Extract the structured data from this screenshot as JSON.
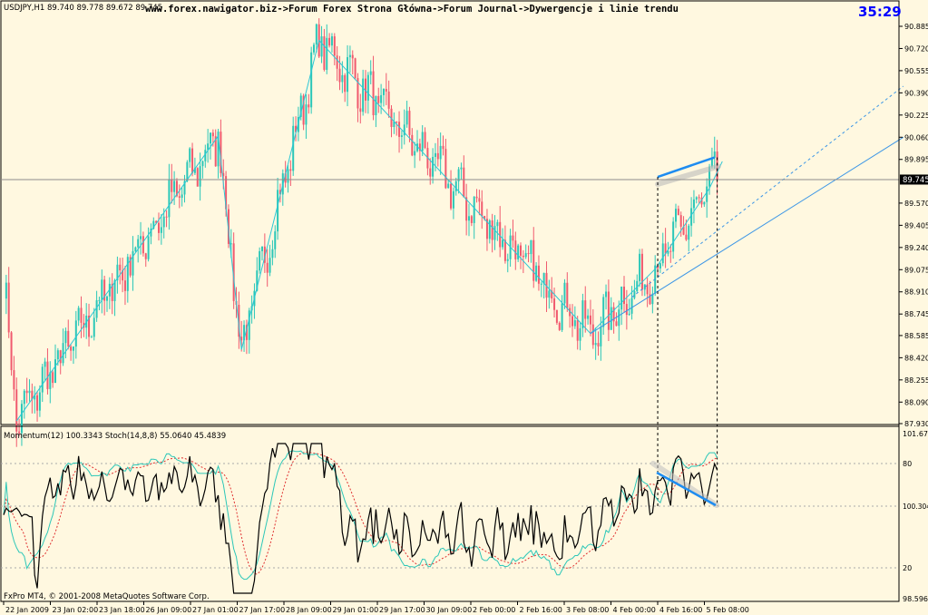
{
  "header": {
    "symbol_info": "USDJPY,H1  89.740 89.778 89.672 89.745",
    "title": "www.forex.nawigator.biz->Forum Forex Strona Główna->Forum Journal->Dywergencje i linie trendu",
    "timer": "35:29"
  },
  "indicator_label": "Momentum(12) 100.3343  Stoch(14,8,8) 55.0640 45.4839",
  "footer": "FxPro MT4, © 2001-2008 MetaQuotes Software Corp.",
  "colors": {
    "background": "#FFF8E0",
    "bull": "#2BC7B8",
    "bear": "#F05A6E",
    "zigzag": "#2BC7D6",
    "trendline": "#3C96E6",
    "divergence": "#1E8CF0",
    "momentum": "#000000",
    "stoch_main": "#2BC7B8",
    "stoch_signal": "#E03030",
    "timer": "#0000FF"
  },
  "chart_data": [
    {
      "type": "candlestick",
      "symbol": "USDJPY",
      "timeframe": "H1",
      "ylim": [
        87.93,
        90.885
      ],
      "y_ticks": [
        "90.885",
        "90.720",
        "90.555",
        "90.390",
        "90.225",
        "90.060",
        "89.895",
        "89.570",
        "89.405",
        "89.240",
        "89.075",
        "88.910",
        "88.745",
        "88.585",
        "88.420",
        "88.255",
        "88.090",
        "87.930"
      ],
      "current_price": "89.745",
      "x_ticks": [
        "22 Jan 2009",
        "23 Jan 02:00",
        "23 Jan 18:00",
        "26 Jan 09:00",
        "27 Jan 01:00",
        "27 Jan 17:00",
        "28 Jan 09:00",
        "29 Jan 01:00",
        "29 Jan 17:00",
        "30 Jan 09:00",
        "2 Feb 00:00",
        "2 Feb 16:00",
        "3 Feb 08:00",
        "4 Feb 00:00",
        "4 Feb 16:00",
        "5 Feb 08:00"
      ],
      "zigzag": [
        {
          "bar": 5,
          "price": 87.95
        },
        {
          "bar": 83,
          "price": 90.07
        },
        {
          "bar": 92,
          "price": 88.48
        },
        {
          "bar": 122,
          "price": 90.78
        },
        {
          "bar": 227,
          "price": 88.6
        },
        {
          "bar": 252,
          "price": 89.08
        },
        {
          "bar": 273,
          "price": 89.68
        },
        {
          "bar": 278,
          "price": 89.88
        }
      ],
      "trendlines": [
        {
          "from": {
            "bar": 227,
            "price": 88.6
          },
          "to": {
            "bar": 348,
            "price": 90.06
          }
        },
        {
          "from": {
            "bar": 243,
            "price": 88.87
          },
          "to": {
            "bar": 348,
            "price": 90.44
          },
          "dashed": true
        }
      ],
      "divergence_line": {
        "from": {
          "bar": 253,
          "price": 89.765
        },
        "to": {
          "bar": 275,
          "price": 89.91
        }
      }
    },
    {
      "type": "line",
      "series": [
        {
          "name": "Momentum(12)",
          "last": 100.3343
        },
        {
          "name": "Stoch(14,8,8)",
          "main": 55.064,
          "signal": 45.4839
        }
      ],
      "y_ticks": [
        "101.676",
        "80",
        "100.3048",
        "20",
        "98.5969"
      ],
      "levels": [
        80,
        20
      ],
      "divergence_line": {
        "from_bar": 253,
        "to_bar": 276,
        "trend": "down"
      }
    }
  ]
}
